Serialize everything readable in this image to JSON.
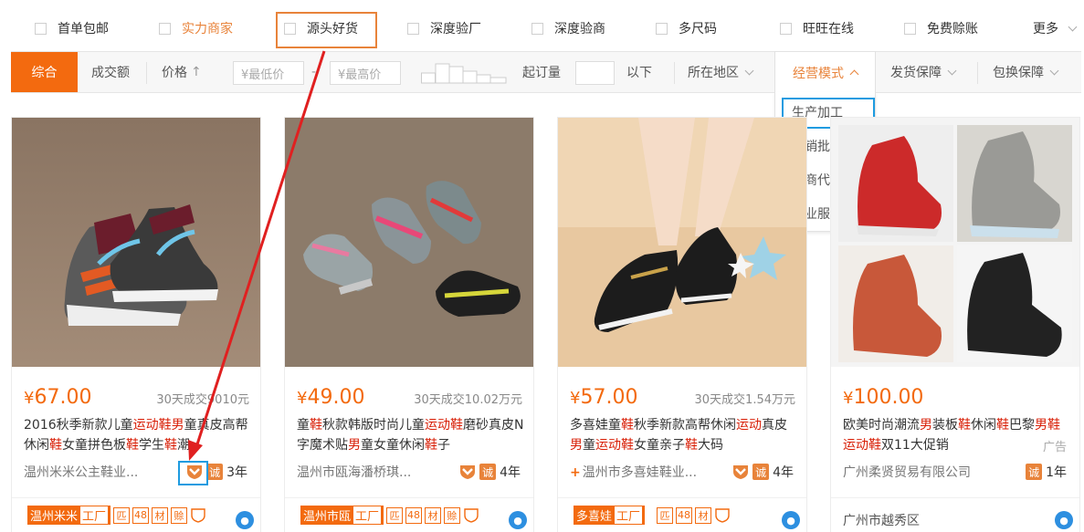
{
  "filters": [
    "首单包邮",
    "实力商家",
    "源头好货",
    "深度验厂",
    "深度验商",
    "多尺码",
    "旺旺在线",
    "免费赊账"
  ],
  "more": "更多",
  "sort": {
    "active": "综合",
    "volume": "成交额",
    "price": "价格",
    "price_arrow": "↑",
    "min_price": "¥最低价",
    "dash": "-",
    "max_price": "¥最高价",
    "moq": "起订量",
    "below": "以下",
    "region": "所在地区",
    "mode": "经营模式",
    "ship": "发货保障",
    "exchange": "包换保障"
  },
  "dropdown": [
    "生产加工",
    "经销批发",
    "招商代理",
    "商业服务"
  ],
  "cards": [
    {
      "price": "67.00",
      "sales": "30天成交9010元",
      "title": [
        [
          "2016秋季新款儿童",
          ""
        ],
        [
          "运动鞋",
          "r"
        ],
        [
          "男",
          "r"
        ],
        [
          "童真皮高帮休闲",
          ""
        ],
        [
          "鞋",
          "r"
        ],
        [
          "女童拼色板",
          ""
        ],
        [
          "鞋",
          "r"
        ],
        [
          "学生",
          ""
        ],
        [
          "鞋",
          "r"
        ],
        [
          "潮",
          ""
        ]
      ],
      "seller": "温州米米公主鞋业...",
      "years": "3年",
      "tag": "温州米米",
      "tag_w": "工厂",
      "small": [
        "匹",
        "48",
        "材",
        "赊"
      ]
    },
    {
      "price": "49.00",
      "sales": "30天成交10.02万元",
      "title": [
        [
          "童",
          ""
        ],
        [
          "鞋",
          "r"
        ],
        [
          "秋款韩版时尚儿童",
          ""
        ],
        [
          "运动鞋",
          "r"
        ],
        [
          "磨砂真皮N字魔术贴",
          ""
        ],
        [
          "男",
          "r"
        ],
        [
          "童女童休闲",
          ""
        ],
        [
          "鞋",
          "r"
        ],
        [
          "子",
          ""
        ]
      ],
      "seller": "温州市瓯海潘桥琪...",
      "years": "4年",
      "tag": "温州市瓯",
      "tag_w": "工厂",
      "small": [
        "匹",
        "48",
        "材",
        "赊"
      ]
    },
    {
      "price": "57.00",
      "sales": "30天成交1.54万元",
      "title": [
        [
          "多喜娃童",
          ""
        ],
        [
          "鞋",
          "r"
        ],
        [
          "秋季新款高帮休闲",
          ""
        ],
        [
          "运动",
          "r"
        ],
        [
          "真皮",
          ""
        ],
        [
          "男",
          "r"
        ],
        [
          "童",
          ""
        ],
        [
          "运动鞋",
          "r"
        ],
        [
          "女童亲子",
          ""
        ],
        [
          "鞋",
          "r"
        ],
        [
          "大码",
          ""
        ]
      ],
      "seller": "温州市多喜娃鞋业...",
      "years": "4年",
      "tag": "多喜娃",
      "tag_w": "工厂",
      "small": [
        "匹",
        "48",
        "材"
      ]
    },
    {
      "price": "100.00",
      "sales": "",
      "title": [
        [
          "欧美时尚潮流",
          ""
        ],
        [
          "男",
          "r"
        ],
        [
          "装板",
          ""
        ],
        [
          "鞋",
          "r"
        ],
        [
          "休闲",
          ""
        ],
        [
          "鞋",
          "r"
        ],
        [
          "巴黎",
          ""
        ],
        [
          "男",
          "r"
        ],
        [
          "鞋",
          "r"
        ],
        [
          "运动鞋",
          "r"
        ],
        [
          "双11大促销",
          ""
        ]
      ],
      "seller": "广州柔贤贸易有限公司",
      "years": "1年",
      "ad": "广告",
      "location": "广州市越秀区"
    }
  ],
  "icons": {
    "cheng": "诚",
    "ww": "●"
  },
  "colors": {
    "accent": "#f36a0f",
    "highlight": "#1e9be0",
    "arrow": "#e02020"
  }
}
